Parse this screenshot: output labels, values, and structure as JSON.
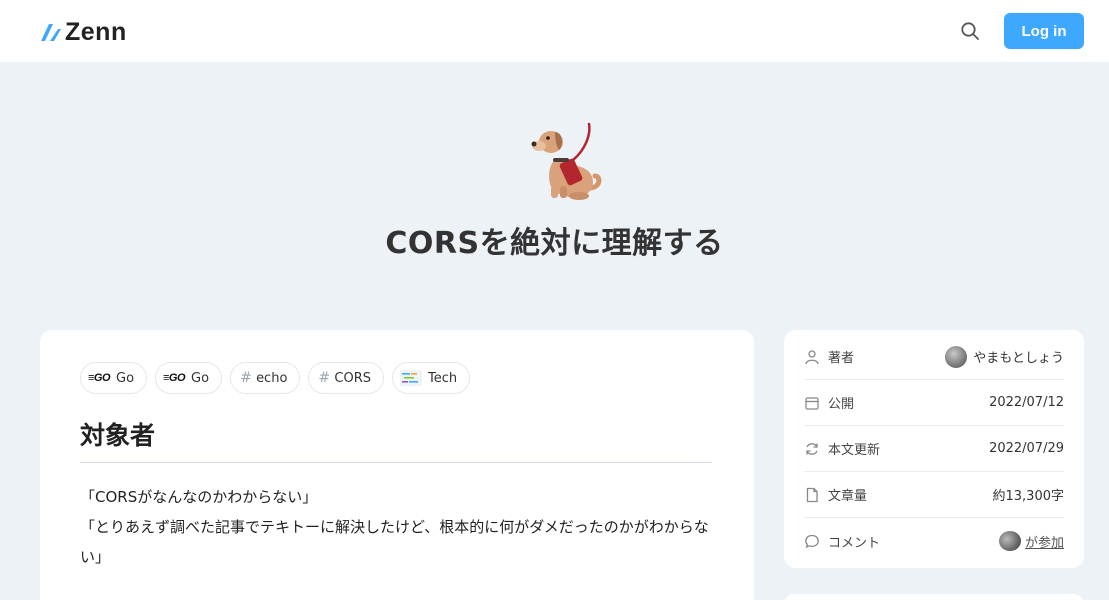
{
  "header": {
    "logo_text": "Zenn",
    "login_label": "Log in"
  },
  "article": {
    "emoji": "guide-dog",
    "title": "CORSを絶対に理解する",
    "topics": [
      {
        "label": "Go",
        "icon": "go-logo"
      },
      {
        "label": "Go",
        "icon": "go-logo"
      },
      {
        "label": "echo",
        "icon": "hash"
      },
      {
        "label": "CORS",
        "icon": "hash"
      },
      {
        "label": "Tech",
        "icon": "code-editor"
      }
    ],
    "heading": "対象者",
    "lines": [
      "「CORSがなんなのかわからない」",
      "「とりあえず調べた記事でテキトーに解決したけど、根本的に何がダメだったのかがわからない」"
    ]
  },
  "sidebar": {
    "author_label": "著者",
    "author_name": "やまもとしょう",
    "published_label": "公開",
    "published_date": "2022/07/12",
    "updated_label": "本文更新",
    "updated_date": "2022/07/29",
    "length_label": "文章量",
    "length_value": "約13,300字",
    "comment_label": "コメント",
    "comment_value": "が参加"
  },
  "colors": {
    "accent": "#3ea8ff",
    "background": "#edf2f7"
  }
}
